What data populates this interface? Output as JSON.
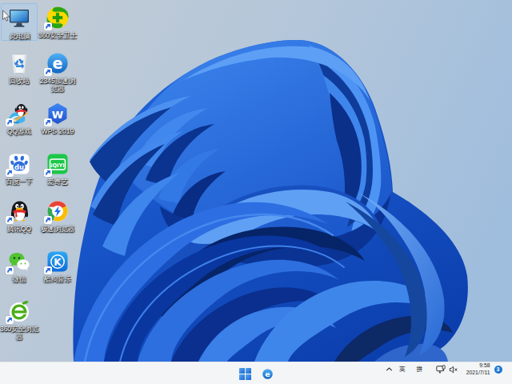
{
  "desktop": {
    "icons": [
      {
        "label": "此电脑",
        "icon": "computer",
        "shortcut": false,
        "selected": true,
        "col": 0,
        "row": 0
      },
      {
        "label": "360安全卫士",
        "icon": "safe360",
        "shortcut": true,
        "selected": false,
        "col": 1,
        "row": 0
      },
      {
        "label": "回收站",
        "icon": "recycle",
        "shortcut": false,
        "selected": false,
        "col": 0,
        "row": 1
      },
      {
        "label": "2345加速浏览器",
        "icon": "browser2345",
        "shortcut": true,
        "selected": false,
        "col": 1,
        "row": 1
      },
      {
        "label": "QQ游戏",
        "icon": "qqgame",
        "shortcut": true,
        "selected": false,
        "col": 0,
        "row": 2
      },
      {
        "label": "WPS 2019",
        "icon": "wps",
        "shortcut": true,
        "selected": false,
        "col": 1,
        "row": 2
      },
      {
        "label": "百度一下",
        "icon": "baidu",
        "shortcut": true,
        "selected": false,
        "col": 0,
        "row": 3
      },
      {
        "label": "爱奇艺",
        "icon": "iqiyi",
        "shortcut": true,
        "selected": false,
        "col": 1,
        "row": 3
      },
      {
        "label": "腾讯QQ",
        "icon": "qq",
        "shortcut": true,
        "selected": false,
        "col": 0,
        "row": 4
      },
      {
        "label": "极速浏览器",
        "icon": "jisu",
        "shortcut": true,
        "selected": false,
        "col": 1,
        "row": 4
      },
      {
        "label": "微信",
        "icon": "wechat",
        "shortcut": true,
        "selected": false,
        "col": 0,
        "row": 5
      },
      {
        "label": "酷狗音乐",
        "icon": "kugou",
        "shortcut": true,
        "selected": false,
        "col": 1,
        "row": 5
      },
      {
        "label": "360安全浏览器",
        "icon": "browser360",
        "shortcut": true,
        "selected": false,
        "col": 0,
        "row": 6
      }
    ]
  },
  "taskbar": {
    "tray": {
      "ime_en": "英",
      "ime_pinyin": "拼",
      "time": "9:58",
      "date": "2021/7/11",
      "badge_count": "3"
    }
  },
  "colors": {
    "taskbar_bg": "#f3f5f7",
    "badge_blue": "#1d76d2",
    "bloom_deep": "#0a3fa6",
    "bloom_mid": "#1f66dd",
    "bloom_light": "#5c9bf2",
    "background_sky": "#aec4da"
  }
}
